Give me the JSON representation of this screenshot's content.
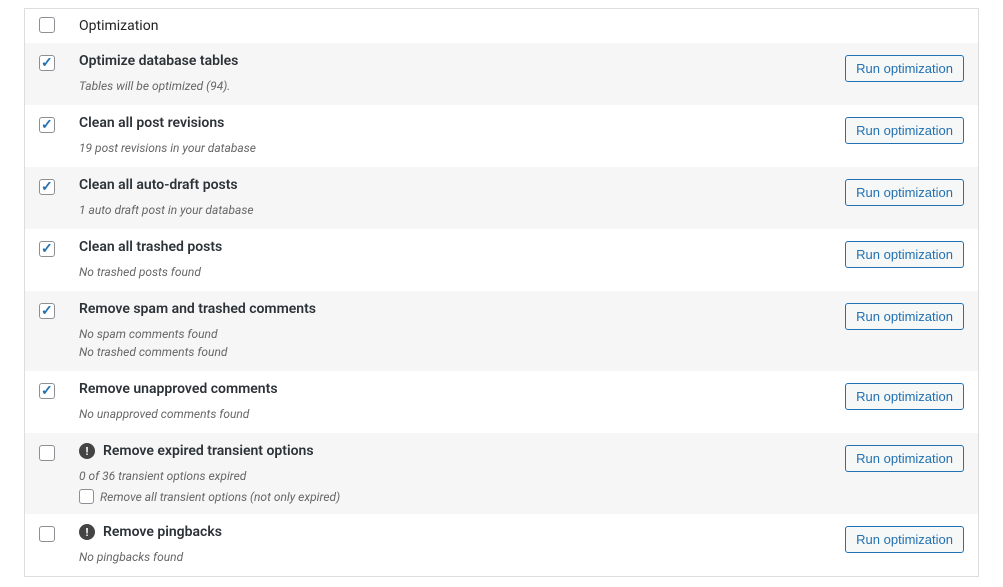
{
  "header": {
    "column_label": "Optimization"
  },
  "button_label": "Run optimization",
  "rows": [
    {
      "checked": true,
      "warn": false,
      "title": "Optimize database tables",
      "details": [
        "Tables will be optimized (94)."
      ]
    },
    {
      "checked": true,
      "warn": false,
      "title": "Clean all post revisions",
      "details": [
        "19 post revisions in your database"
      ]
    },
    {
      "checked": true,
      "warn": false,
      "title": "Clean all auto-draft posts",
      "details": [
        "1 auto draft post in your database"
      ]
    },
    {
      "checked": true,
      "warn": false,
      "title": "Clean all trashed posts",
      "details": [
        "No trashed posts found"
      ]
    },
    {
      "checked": true,
      "warn": false,
      "title": "Remove spam and trashed comments",
      "details": [
        "No spam comments found",
        "No trashed comments found"
      ]
    },
    {
      "checked": true,
      "warn": false,
      "title": "Remove unapproved comments",
      "details": [
        "No unapproved comments found"
      ]
    },
    {
      "checked": false,
      "warn": true,
      "title": "Remove expired transient options",
      "details": [
        "0 of 36 transient options expired"
      ],
      "sub_option": "Remove all transient options (not only expired)"
    },
    {
      "checked": false,
      "warn": true,
      "title": "Remove pingbacks",
      "details": [
        "No pingbacks found"
      ]
    }
  ]
}
